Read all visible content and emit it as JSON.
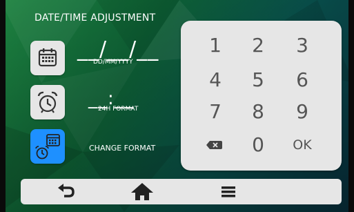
{
  "screen_title": "DATE/TIME ADJUSTMENT",
  "date": {
    "value": "__/__/__",
    "format_hint": "DD/MM/YYYY"
  },
  "time": {
    "value": "__:__",
    "format_hint": "24H FORMAT"
  },
  "change_format_label": "CHANGE FORMAT",
  "keypad": {
    "row1": [
      "1",
      "2",
      "3"
    ],
    "row2": [
      "4",
      "5",
      "6"
    ],
    "row3": [
      "7",
      "8",
      "9"
    ],
    "row4": {
      "backspace_icon": "backspace-icon",
      "zero": "0",
      "ok": "OK"
    }
  },
  "bottom_bar": {
    "icons": [
      "back-icon",
      "home-icon",
      "menu-icon"
    ]
  },
  "colors": {
    "accent_blue": "#1e90ff",
    "panel_gray": "#e6e6e6",
    "icon_dark": "#333333"
  }
}
